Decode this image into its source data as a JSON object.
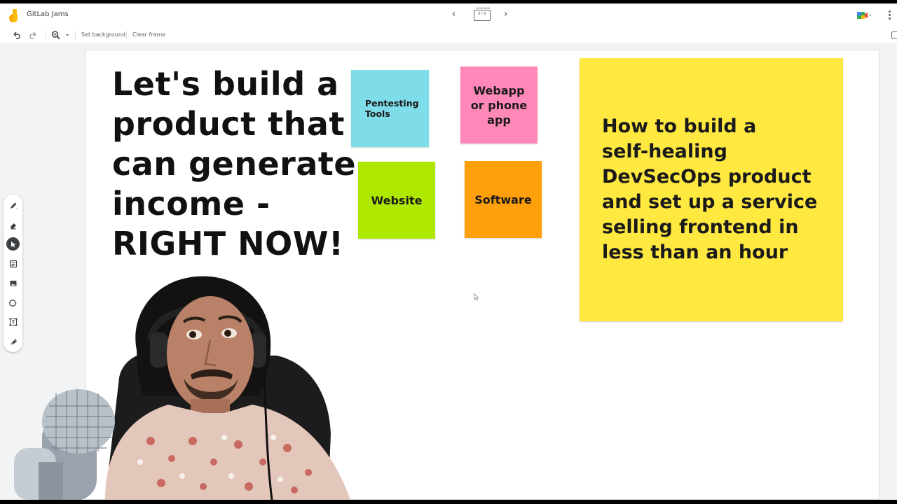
{
  "app": {
    "title": "GitLab Jams",
    "frame_counter": "9 / 9"
  },
  "toolbar": {
    "set_background": "Set background",
    "clear_frame": "Clear frame"
  },
  "headline": {
    "lines": [
      "Let's build a",
      "product that",
      "can generate",
      "income -",
      "RIGHT NOW!"
    ]
  },
  "stickies": {
    "pentesting": {
      "lines": [
        "Pentesting",
        "Tools"
      ],
      "color": "#7fdde9"
    },
    "webapp": {
      "lines": [
        "Webapp",
        "or phone",
        "app"
      ],
      "color": "#ff88b8"
    },
    "website": {
      "label": "Website",
      "color": "#aee800"
    },
    "software": {
      "label": "Software",
      "color": "#ff9f0a"
    },
    "devsecops": {
      "lines": [
        "How to build a",
        "self-healing",
        "DevSecOps product",
        "and set up a service",
        "selling frontend in",
        "less than an hour"
      ],
      "color": "#ffe83f"
    }
  },
  "icons": {
    "logo": "jamboard-logo-icon",
    "prev": "chevron-left-icon",
    "next": "chevron-right-icon",
    "meet": "meet-present-icon",
    "undo": "undo-icon",
    "redo": "redo-icon",
    "zoom": "zoom-icon",
    "tools": [
      "pen-icon",
      "eraser-icon",
      "select-icon",
      "sticky-note-icon",
      "image-icon",
      "circle-icon",
      "text-box-icon",
      "laser-icon"
    ]
  }
}
